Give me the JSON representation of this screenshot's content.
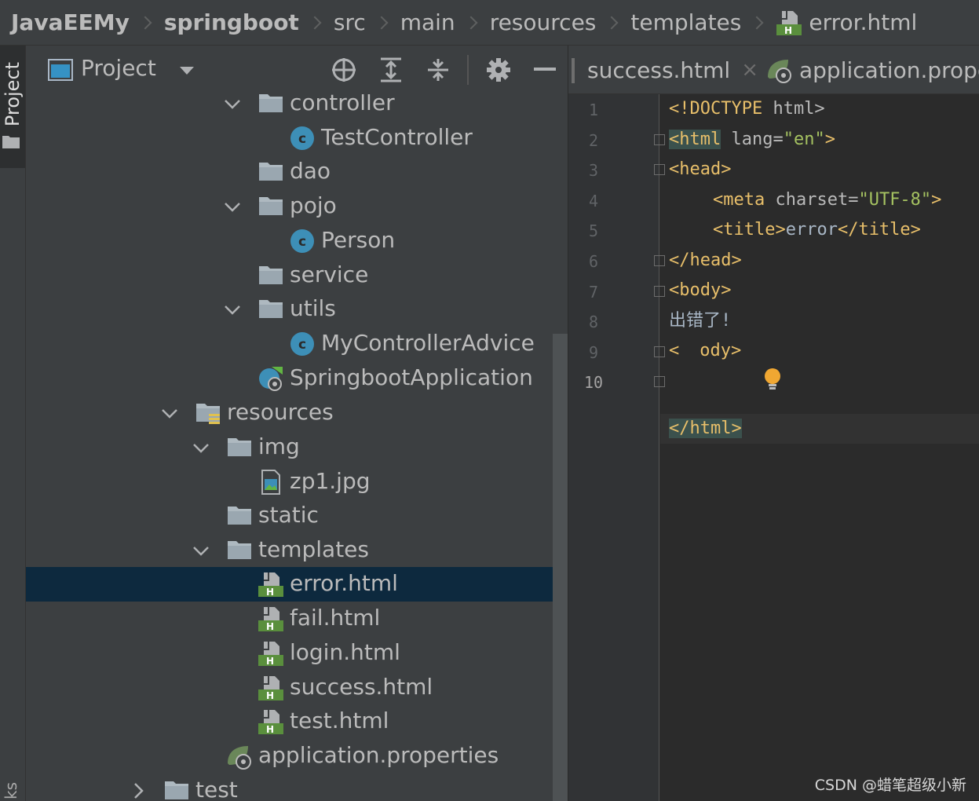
{
  "breadcrumb": [
    {
      "label": "JavaEEMy",
      "bold": true
    },
    {
      "label": "springboot",
      "bold": true
    },
    {
      "label": "src",
      "bold": false
    },
    {
      "label": "main",
      "bold": false
    },
    {
      "label": "resources",
      "bold": false
    },
    {
      "label": "templates",
      "bold": false
    },
    {
      "label": "error.html",
      "bold": false,
      "icon": "html-file-icon"
    }
  ],
  "left_strip": {
    "project_label": "Project",
    "bottom_label": "ks"
  },
  "panel": {
    "title": "Project"
  },
  "tree": [
    {
      "label": "controller",
      "icon": "folder-icon",
      "expanded": true
    },
    {
      "label": "TestController",
      "icon": "java-class-icon"
    },
    {
      "label": "dao",
      "icon": "folder-icon"
    },
    {
      "label": "pojo",
      "icon": "folder-icon",
      "expanded": true
    },
    {
      "label": "Person",
      "icon": "java-class-icon"
    },
    {
      "label": "service",
      "icon": "folder-icon"
    },
    {
      "label": "utils",
      "icon": "folder-icon",
      "expanded": true
    },
    {
      "label": "MyControllerAdvice",
      "icon": "java-class-icon"
    },
    {
      "label": "SpringbootApplication",
      "icon": "spring-boot-app-icon"
    },
    {
      "label": "resources",
      "icon": "resources-folder-icon",
      "expanded": true
    },
    {
      "label": "img",
      "icon": "folder-icon",
      "expanded": true
    },
    {
      "label": "zp1.jpg",
      "icon": "image-file-icon"
    },
    {
      "label": "static",
      "icon": "folder-icon"
    },
    {
      "label": "templates",
      "icon": "folder-icon",
      "expanded": true
    },
    {
      "label": "error.html",
      "icon": "html-file-icon",
      "selected": true
    },
    {
      "label": "fail.html",
      "icon": "html-file-icon"
    },
    {
      "label": "login.html",
      "icon": "html-file-icon"
    },
    {
      "label": "success.html",
      "icon": "html-file-icon"
    },
    {
      "label": "test.html",
      "icon": "html-file-icon"
    },
    {
      "label": "application.properties",
      "icon": "spring-properties-icon"
    },
    {
      "label": "test",
      "icon": "folder-icon",
      "expanded": false
    }
  ],
  "editor": {
    "tabs": [
      {
        "label": "success.html",
        "close": "×"
      },
      {
        "label": "application.prope"
      }
    ],
    "line_numbers": [
      "1",
      "2",
      "3",
      "4",
      "5",
      "6",
      "7",
      "8",
      "9",
      "10"
    ],
    "current_line": "10",
    "code": {
      "l1_tag": "<!DOCTYPE ",
      "l1_rest": "html>",
      "l2_tag": "<html",
      "l2_attr": " lang=",
      "l2_val": "\"en\"",
      "l2_end": ">",
      "l3_tag": "<head>",
      "l4_tag": "<meta",
      "l4_attr": " charset=",
      "l4_val": "\"UTF-8\"",
      "l4_end": ">",
      "l5_open": "<title>",
      "l5_text": "error",
      "l5_close": "</title>",
      "l6_tag": "</head>",
      "l7_tag": "<body>",
      "l8_text": "出错了!",
      "l9_a": "<",
      "l9_b": "ody>",
      "l10_tag": "</html>"
    }
  },
  "watermark": "CSDN @蜡笔超级小新",
  "colors": {
    "accent_select": "#0d293e",
    "tag": "#e8bf6a",
    "value": "#a5c261",
    "panel_bg": "#3c3f41",
    "editor_bg": "#2b2b2b"
  }
}
